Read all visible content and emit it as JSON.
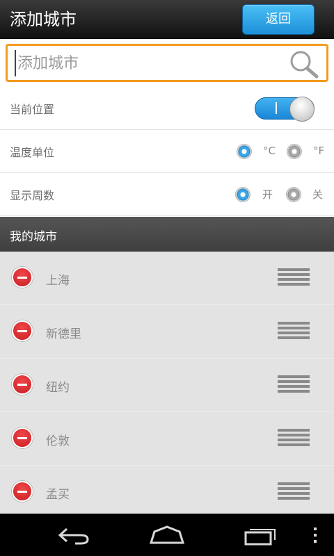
{
  "titlebar": {
    "title": "添加城市",
    "back_label": "返回"
  },
  "search": {
    "placeholder": "添加城市",
    "value": ""
  },
  "settings": {
    "location_label": "当前位置",
    "location_on": true,
    "temp_label": "温度单位",
    "temp_options": [
      "°C",
      "°F"
    ],
    "temp_selected": "°C",
    "week_label": "显示周数",
    "week_options": [
      "开",
      "关"
    ],
    "week_selected": "开"
  },
  "section": {
    "title": "我的城市"
  },
  "cities": [
    "上海",
    "新德里",
    "纽约",
    "伦敦",
    "孟买"
  ],
  "colors": {
    "accent": "#1c8fd9",
    "search_border": "#f39a1e",
    "delete": "#d12226"
  }
}
